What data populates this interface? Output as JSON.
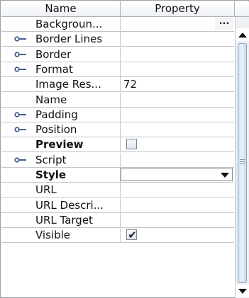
{
  "header": {
    "name_label": "Name",
    "property_label": "Property"
  },
  "rows": [
    {
      "label": "Backgroun...",
      "value": "",
      "expandable": false,
      "bold": false,
      "editor": "ellipsis",
      "editor_label": "..."
    },
    {
      "label": "Border Lines",
      "value": "",
      "expandable": true,
      "bold": false,
      "editor": "none"
    },
    {
      "label": "Border",
      "value": "",
      "expandable": true,
      "bold": false,
      "editor": "none"
    },
    {
      "label": "Format",
      "value": "",
      "expandable": true,
      "bold": false,
      "editor": "none"
    },
    {
      "label": "Image Res...",
      "value": "72",
      "expandable": false,
      "bold": false,
      "editor": "text"
    },
    {
      "label": "Name",
      "value": "",
      "expandable": false,
      "bold": false,
      "editor": "none"
    },
    {
      "label": "Padding",
      "value": "",
      "expandable": true,
      "bold": false,
      "editor": "none"
    },
    {
      "label": "Position",
      "value": "",
      "expandable": true,
      "bold": false,
      "editor": "none"
    },
    {
      "label": "Preview",
      "value": "",
      "expandable": false,
      "bold": true,
      "editor": "checkbox",
      "checked": false
    },
    {
      "label": "Script",
      "value": "",
      "expandable": true,
      "bold": false,
      "editor": "none"
    },
    {
      "label": "Style",
      "value": "",
      "expandable": false,
      "bold": true,
      "editor": "combo"
    },
    {
      "label": "URL",
      "value": "",
      "expandable": false,
      "bold": false,
      "editor": "none"
    },
    {
      "label": "URL Descri...",
      "value": "",
      "expandable": false,
      "bold": false,
      "editor": "none"
    },
    {
      "label": "URL Target",
      "value": "",
      "expandable": false,
      "bold": false,
      "editor": "none"
    },
    {
      "label": "Visible",
      "value": "",
      "expandable": false,
      "bold": false,
      "editor": "checkbox",
      "checked": true
    }
  ],
  "icons": {
    "expand": "key-expand-icon",
    "scroll_up": "scroll-up-arrow-icon",
    "scroll_down": "scroll-down-arrow-icon",
    "combo_arrow": "dropdown-arrow-icon",
    "checkmark": "checkmark-icon"
  },
  "checkmark_glyph": "✔",
  "colors": {
    "grid_line": "#c6c6c6",
    "scroll_thumb": "#cfe0f1",
    "header_bg": "#eef1f5"
  }
}
